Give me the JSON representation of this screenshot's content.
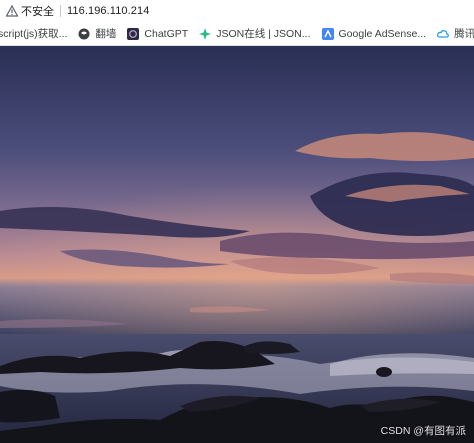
{
  "addressbar": {
    "security_text": "不安全",
    "url": "116.196.110.214"
  },
  "bookmarks": [
    {
      "label": "script(js)获取...",
      "icon": "page-icon"
    },
    {
      "label": "翻墙",
      "icon": "globe-icon"
    },
    {
      "label": "ChatGPT",
      "icon": "chatgpt-icon"
    },
    {
      "label": "JSON在线 | JSON...",
      "icon": "json-icon"
    },
    {
      "label": "Google AdSense...",
      "icon": "adsense-icon"
    },
    {
      "label": "腾讯云-轻量级服务...",
      "icon": "cloud-icon"
    }
  ],
  "photo": {
    "subject": "seascape at dusk",
    "watermark": "CSDN @有图有派"
  },
  "colors": {
    "sky_top": "#2c3157",
    "sky_horizon": "#d69a87",
    "sea": "#3a3f5e",
    "rocks": "#14141c"
  }
}
